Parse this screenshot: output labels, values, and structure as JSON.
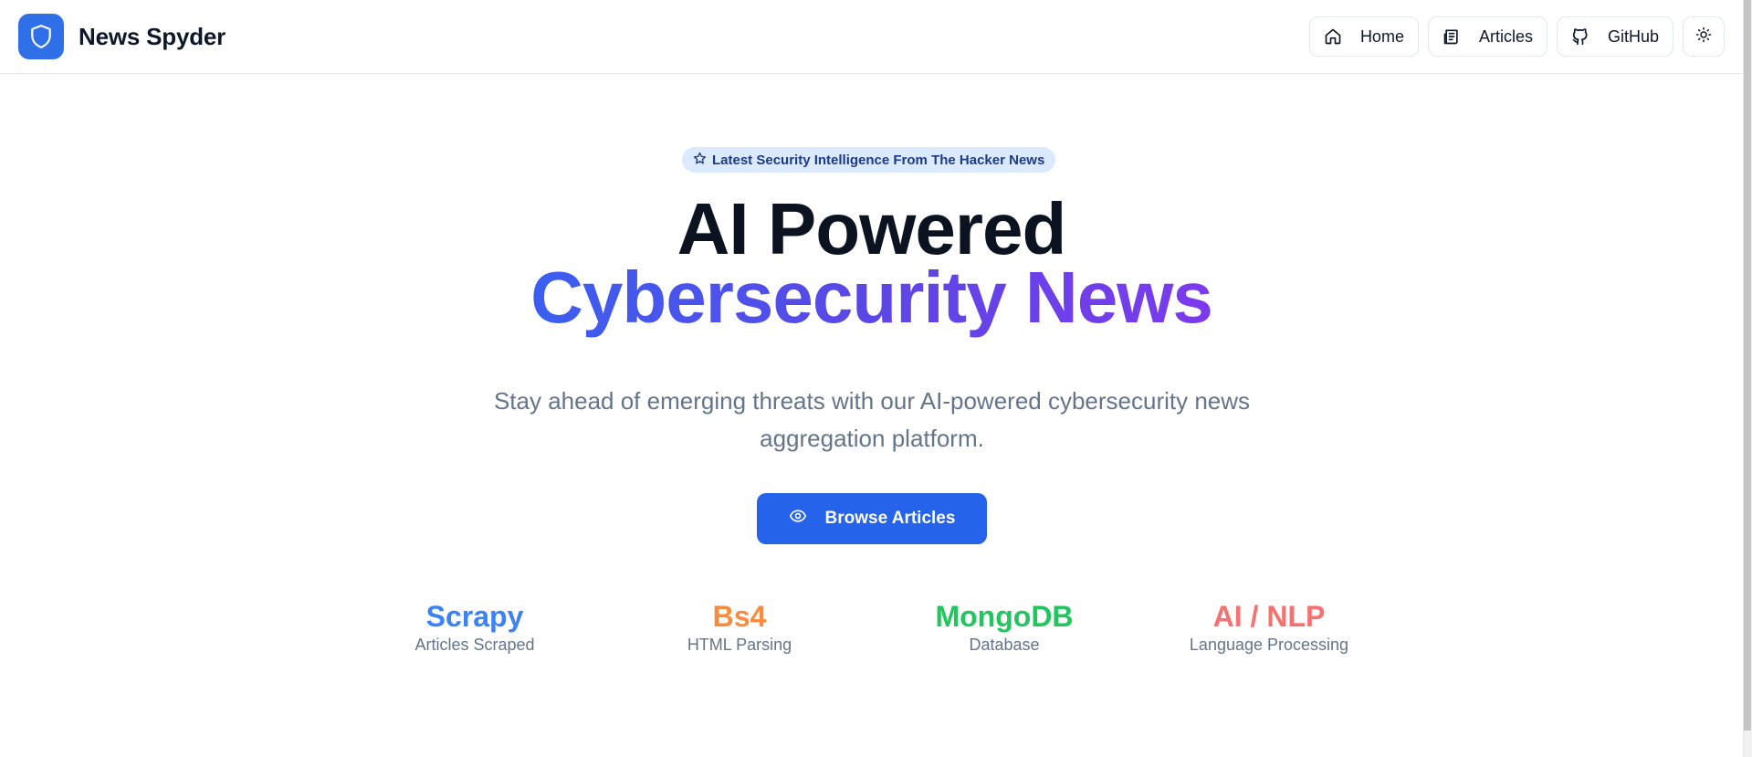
{
  "header": {
    "brand_name": "News Spyder",
    "nav": [
      {
        "label": "Home",
        "icon": "home-icon"
      },
      {
        "label": "Articles",
        "icon": "newspaper-icon"
      },
      {
        "label": "GitHub",
        "icon": "github-icon"
      }
    ],
    "theme_toggle_icon": "sun-icon"
  },
  "hero": {
    "badge": "Latest Security Intelligence From The Hacker News",
    "title_line1": "AI Powered",
    "title_line2": "Cybersecurity News",
    "subtitle": "Stay ahead of emerging threats with our AI-powered cybersecurity news aggregation platform.",
    "cta_label": "Browse Articles"
  },
  "stats": [
    {
      "value": "Scrapy",
      "label": "Articles Scraped",
      "color": "#3b82f6"
    },
    {
      "value": "Bs4",
      "label": "HTML Parsing",
      "color": "#fb8b3c"
    },
    {
      "value": "MongoDB",
      "label": "Database",
      "color": "#22c55e"
    },
    {
      "value": "AI / NLP",
      "label": "Language Processing",
      "color": "#f87171"
    }
  ],
  "colors": {
    "brand": "#2f6fe8",
    "cta": "#2563eb",
    "badge_bg": "#dbeafe",
    "gradient_start": "#3b5ff0",
    "gradient_end": "#7c3aed"
  }
}
